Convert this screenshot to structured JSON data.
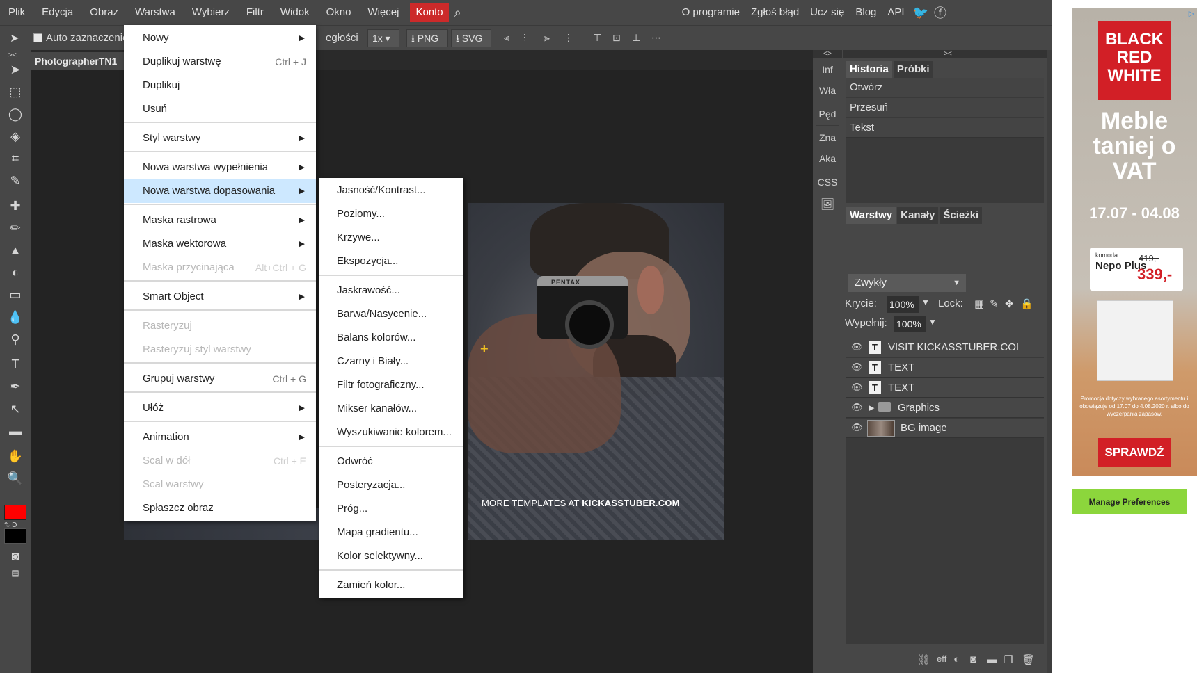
{
  "menubar": {
    "items": [
      "Plik",
      "Edycja",
      "Obraz",
      "Warstwa",
      "Wybierz",
      "Filtr",
      "Widok",
      "Okno",
      "Więcej"
    ],
    "account": "Konto",
    "right_items": [
      "O programie",
      "Zgłoś błąd",
      "Ucz się",
      "Blog",
      "API"
    ]
  },
  "optbar": {
    "auto_select": "Auto zaznaczenie",
    "trailing": "egłości",
    "zoom": "1x",
    "png": "PNG",
    "svg": "SVG"
  },
  "document": {
    "tab_title": "PhotographerTN1"
  },
  "canvas": {
    "camera_brand": "PENTAX",
    "caption_prefix": "MORE TEMPLATES AT ",
    "caption_site": "KICKASSTUBER.COM"
  },
  "layer_menu": {
    "items": [
      {
        "label": "Nowy",
        "shortcut": "",
        "arrow": "▶",
        "disabled": false
      },
      {
        "label": "Duplikuj warstwę",
        "shortcut": "Ctrl + J",
        "arrow": "",
        "disabled": false
      },
      {
        "label": "Duplikuj",
        "shortcut": "",
        "arrow": "",
        "disabled": false
      },
      {
        "label": "Usuń",
        "shortcut": "",
        "arrow": "",
        "disabled": false
      },
      {
        "label": "Styl warstwy",
        "shortcut": "",
        "arrow": "▶",
        "disabled": false
      },
      {
        "label": "Nowa warstwa wypełnienia",
        "shortcut": "",
        "arrow": "▶",
        "disabled": false
      },
      {
        "label": "Nowa warstwa dopasowania",
        "shortcut": "",
        "arrow": "▶",
        "disabled": false,
        "highlighted": true
      },
      {
        "label": "Maska rastrowa",
        "shortcut": "",
        "arrow": "▶",
        "disabled": false
      },
      {
        "label": "Maska wektorowa",
        "shortcut": "",
        "arrow": "▶",
        "disabled": false
      },
      {
        "label": "Maska przycinająca",
        "shortcut": "Alt+Ctrl + G",
        "arrow": "",
        "disabled": true
      },
      {
        "label": "Smart Object",
        "shortcut": "",
        "arrow": "▶",
        "disabled": false
      },
      {
        "label": "Rasteryzuj",
        "shortcut": "",
        "arrow": "",
        "disabled": true
      },
      {
        "label": "Rasteryzuj styl warstwy",
        "shortcut": "",
        "arrow": "",
        "disabled": true
      },
      {
        "label": "Grupuj warstwy",
        "shortcut": "Ctrl + G",
        "arrow": "",
        "disabled": false
      },
      {
        "label": "Ułóż",
        "shortcut": "",
        "arrow": "▶",
        "disabled": false
      },
      {
        "label": "Animation",
        "shortcut": "",
        "arrow": "▶",
        "disabled": false
      },
      {
        "label": "Scal w dół",
        "shortcut": "Ctrl + E",
        "arrow": "",
        "disabled": true
      },
      {
        "label": "Scal warstwy",
        "shortcut": "",
        "arrow": "",
        "disabled": true
      },
      {
        "label": "Spłaszcz obraz",
        "shortcut": "",
        "arrow": "",
        "disabled": false
      }
    ]
  },
  "adjust_submenu": {
    "items": [
      "Jasność/Kontrast...",
      "Poziomy...",
      "Krzywe...",
      "Ekspozycja...",
      "Jaskrawość...",
      "Barwa/Nasycenie...",
      "Balans kolorów...",
      "Czarny i Biały...",
      "Filtr fotograficzny...",
      "Mikser kanałów...",
      "Wyszukiwanie kolorem...",
      "Odwróć",
      "Posteryzacja...",
      "Próg...",
      "Mapa gradientu...",
      "Kolor selektywny...",
      "Zamień kolor..."
    ]
  },
  "side_narrow": {
    "items": [
      "Inf",
      "Wła",
      "Pęd",
      "Zna",
      "Aka",
      "CSS"
    ]
  },
  "history": {
    "tabs": [
      "Historia",
      "Próbki"
    ],
    "entries": [
      "Otwórz",
      "Przesuń",
      "Tekst"
    ]
  },
  "layers_panel": {
    "tabs": [
      "Warstwy",
      "Kanały",
      "Ścieżki"
    ],
    "blend_mode": "Zwykły",
    "opacity_label": "Krycie:",
    "opacity_value": "100%",
    "lock_label": "Lock:",
    "fill_label": "Wypełnij:",
    "fill_value": "100%",
    "layers": [
      "VISIT KICKASSTUBER.COI",
      "TEXT",
      "TEXT",
      "Graphics",
      "BG image"
    ],
    "bottom_eff": "eff"
  },
  "ad": {
    "brand": "BLACK RED WHITE",
    "headline": "Meble taniej o VAT",
    "dates": "17.07 - 04.08",
    "tag_small": "komoda",
    "tag_name": "Nepo Plus",
    "old_price": "419,-",
    "new_price": "339,-",
    "fine_print": "Promocja dotyczy wybranego asortymentu i obowiązuje od 17.07 do 4.08.2020 r. albo do wyczerpania zapasów.",
    "cta": "SPRAWDŹ",
    "manage": "Manage Preferences"
  }
}
